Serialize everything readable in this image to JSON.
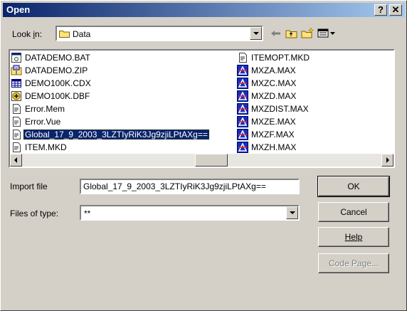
{
  "window": {
    "title": "Open",
    "help_glyph": "?",
    "close_glyph": "✕"
  },
  "look_in": {
    "label": "Look in:",
    "value": "Data"
  },
  "toolbar": {
    "icons": [
      "back-icon",
      "up-folder-icon",
      "new-folder-icon",
      "view-menu-icon"
    ]
  },
  "files": {
    "column1": [
      {
        "name": "DATADEMO.BAT",
        "icon": "batch-file-icon"
      },
      {
        "name": "DATADEMO.ZIP",
        "icon": "zip-file-icon"
      },
      {
        "name": "DEMO100K.CDX",
        "icon": "grid-file-icon"
      },
      {
        "name": "DEMO100K.DBF",
        "icon": "dbf-file-icon"
      },
      {
        "name": "Error.Mem",
        "icon": "document-icon"
      },
      {
        "name": "Error.Vue",
        "icon": "document-icon"
      },
      {
        "name": "Global_17_9_2003_3LZTIyRiK3Jg9zjiLPtAXg==",
        "icon": "document-icon",
        "selected": true
      },
      {
        "name": "ITEM.MKD",
        "icon": "document-icon"
      }
    ],
    "column2": [
      {
        "name": "ITEMOPT.MKD",
        "icon": "document-icon"
      },
      {
        "name": "MXZA.MAX",
        "icon": "max-file-icon"
      },
      {
        "name": "MXZC.MAX",
        "icon": "max-file-icon"
      },
      {
        "name": "MXZD.MAX",
        "icon": "max-file-icon"
      },
      {
        "name": "MXZDIST.MAX",
        "icon": "max-file-icon"
      },
      {
        "name": "MXZE.MAX",
        "icon": "max-file-icon"
      },
      {
        "name": "MXZF.MAX",
        "icon": "max-file-icon"
      },
      {
        "name": "MXZH.MAX",
        "icon": "max-file-icon"
      }
    ]
  },
  "import_file": {
    "label": "Import file",
    "value": "Global_17_9_2003_3LZTIyRiK3Jg9zjiLPtAXg=="
  },
  "files_of_type": {
    "label": "Files of type:",
    "value": "**"
  },
  "buttons": {
    "ok": "OK",
    "cancel": "Cancel",
    "help": "Help",
    "code_page": "Code Page..."
  },
  "colors": {
    "selection": "#0a246a",
    "title_start": "#0a246a",
    "title_end": "#a6caf0",
    "face": "#d4d0c8"
  }
}
